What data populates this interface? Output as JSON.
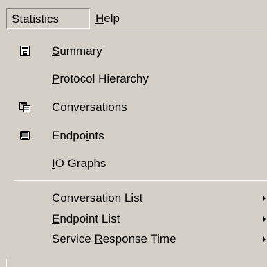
{
  "menubar": {
    "statistics": {
      "pre": "",
      "key": "S",
      "post": "tatistics"
    },
    "help": {
      "pre": "",
      "key": "H",
      "post": "elp"
    }
  },
  "menu": {
    "items": [
      {
        "pre": "",
        "key": "S",
        "post": "ummary",
        "icon": "summary-icon"
      },
      {
        "pre": "",
        "key": "P",
        "post": "rotocol Hierarchy",
        "icon": ""
      },
      {
        "pre": "Con",
        "key": "v",
        "post": "ersations",
        "icon": "conversations-icon"
      },
      {
        "pre": "Endpo",
        "key": "i",
        "post": "nts",
        "icon": "endpoints-icon"
      },
      {
        "pre": "",
        "key": "I",
        "post": "O Graphs",
        "icon": ""
      },
      {
        "pre": "",
        "key": "C",
        "post": "onversation List",
        "icon": "",
        "submenu": true
      },
      {
        "pre": "",
        "key": "E",
        "post": "ndpoint List",
        "icon": "",
        "submenu": true
      },
      {
        "pre": "Service ",
        "key": "R",
        "post": "esponse Time",
        "icon": "",
        "submenu": true
      }
    ]
  }
}
